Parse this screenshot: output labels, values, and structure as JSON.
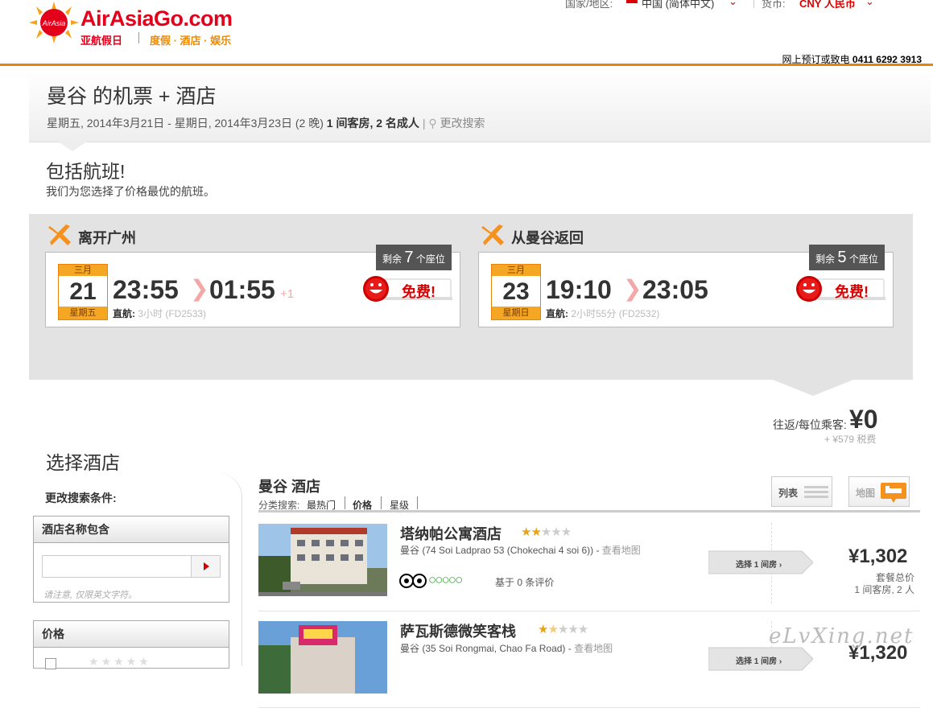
{
  "header": {
    "brand": "AirAsia",
    "brand_go": "Go.com",
    "brand_sub_cn": "亚航假日",
    "brand_tagline": "度假 · 酒店 · 娱乐",
    "top_links": [
      "国家/地区:",
      "中国 (简体中文)",
      "货币:",
      "CNY 人民币"
    ],
    "phone_prefix": "网上预订或致电",
    "phone_number": "0411 6292 3913"
  },
  "search_summary": {
    "title": "曼谷 的机票 + 酒店",
    "dates": "星期五, 2014年3月21日 - 星期日, 2014年3月23日 (2 晚)",
    "rooms_guests": "1 间客房, 2 名成人",
    "modify_label": "更改搜索"
  },
  "flights_section": {
    "heading": "包括航班!",
    "subheading": "我们为您选择了价格最优的航班。",
    "legs": [
      {
        "title": "离开广州",
        "seats_prefix": "剩余",
        "seats_count": "7",
        "seats_suffix": "个座位",
        "month": "三月",
        "day": "21",
        "weekday": "星期五",
        "depart_time": "23:55",
        "arrive_time": "01:55",
        "day_offset": "+1",
        "direct_label": "直航:",
        "duration": "3小时 (FD2533)",
        "free_label": "免费!"
      },
      {
        "title": "从曼谷返回",
        "seats_prefix": "剩余",
        "seats_count": "5",
        "seats_suffix": "个座位",
        "month": "三月",
        "day": "23",
        "weekday": "星期日",
        "depart_time": "19:10",
        "arrive_time": "23:05",
        "day_offset": "",
        "direct_label": "直航:",
        "duration": "2小时55分 (FD2532)",
        "free_label": "免费!"
      }
    ],
    "price_label": "往返/每位乘客:",
    "price_value": "¥0",
    "price_tax": "+ ¥579 税费"
  },
  "hotels_section": {
    "heading": "选择酒店",
    "sidebar": {
      "title": "更改搜索条件:",
      "name_panel_title": "酒店名称包含",
      "name_input_placeholder": "",
      "name_hint": "请注意, 仅限英文字符。",
      "price_panel_title": "价格"
    },
    "results_title": "曼谷 酒店",
    "sort_label": "分类搜索:",
    "sort_options": [
      "最热门",
      "价格",
      "星级"
    ],
    "view_list_label": "列表",
    "view_map_label": "地图",
    "hotels": [
      {
        "name": "塔纳帕公寓酒店",
        "stars": 2,
        "address": "曼谷 (74 Soi Ladprao 53 (Chokechai 4 soi 6))",
        "map_link": "查看地图",
        "review_text": "基于 0 条评价",
        "select_label": "选择 1 间房 ›",
        "price": "¥1,302",
        "price_note": "套餐总价",
        "room_note": "1 间客房, 2 人"
      },
      {
        "name": "萨瓦斯德微笑客栈",
        "stars": 1.5,
        "address": "曼谷 (35 Soi Rongmai, Chao Fa Road)",
        "map_link": "查看地图",
        "review_text": "",
        "select_label": "选择 1 间房 ›",
        "price": "¥1,320",
        "price_note": "",
        "room_note": ""
      }
    ]
  },
  "watermark": "eLvXing.net",
  "colors": {
    "brand_red": "#e3001b",
    "accent_orange": "#e8820c",
    "date_orange": "#f5a623",
    "band_gray": "#e3e3e3"
  }
}
